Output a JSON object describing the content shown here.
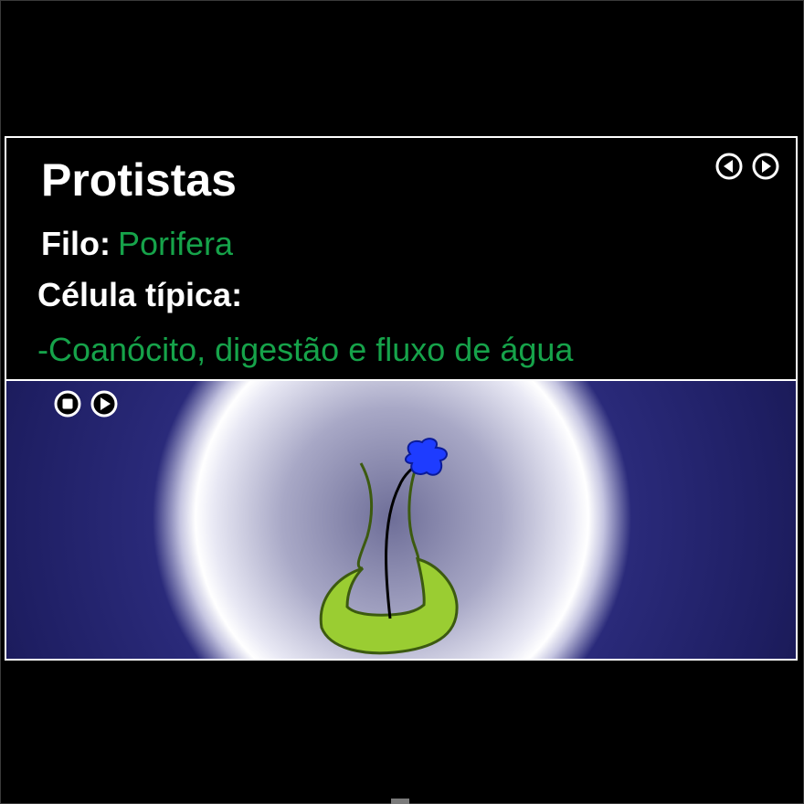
{
  "title": "Protistas",
  "filo": {
    "label": "Filo:",
    "value": "Porifera"
  },
  "cell": {
    "label": "Célula típica:",
    "description": "-Coanócito, digestão e fluxo de água"
  },
  "icons": {
    "prev": "prev-arrow-icon",
    "next": "next-arrow-icon",
    "stop": "stop-icon",
    "play": "play-icon"
  },
  "colors": {
    "accent_green": "#16a34a",
    "cell_body": "#9acd32",
    "flagellum_tip": "#1e3cff",
    "background_deep_blue": "#1e1e62"
  }
}
